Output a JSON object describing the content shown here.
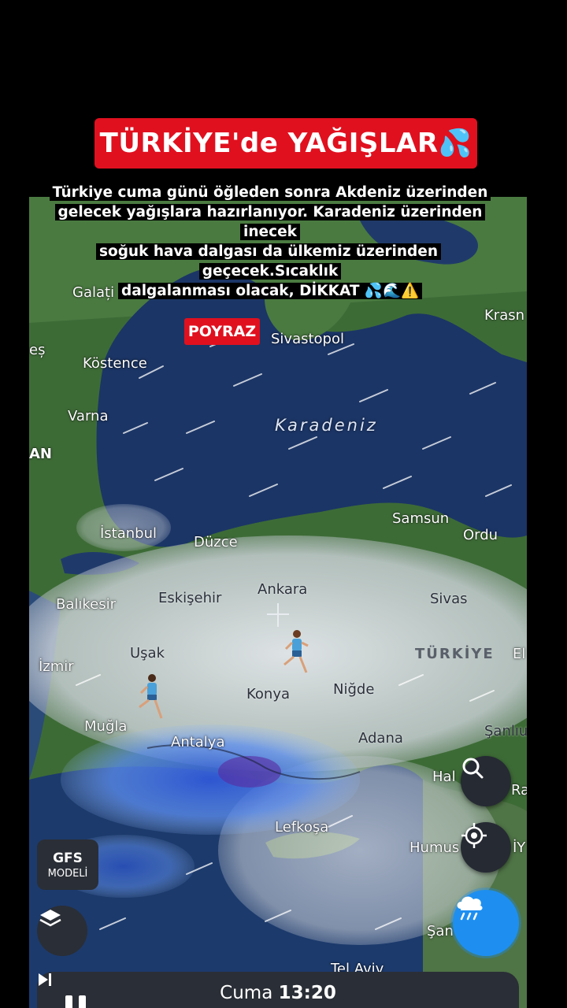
{
  "title": "TÜRKİYE'de YAĞIŞLAR💦",
  "caption_lines": [
    "Türkiye cuma günü öğleden sonra Akdeniz üzerinden",
    "gelecek yağışlara hazırlanıyor. Karadeniz üzerinden inecek",
    "soğuk hava dalgası da ülkemiz üzerinden geçecek.Sıcaklık",
    "dalgalanması olacak, DİKKAT 💦🌊⚠️"
  ],
  "map": {
    "badge": "POYRAZ",
    "sea_label": "Karadeniz",
    "country_label": "TÜRKİYE",
    "cities": {
      "galati": "Galați",
      "krasn": "Krasn",
      "es": "eș",
      "sivastopol": "Sivastopol",
      "kostence": "Köstence",
      "varna": "Varna",
      "an": "AN",
      "samsun": "Samsun",
      "ordu": "Ordu",
      "istanbul": "İstanbul",
      "duzce": "Düzce",
      "ankara": "Ankara",
      "balikesir": "Balıkesir",
      "eskisehir": "Eskişehir",
      "sivas": "Sivas",
      "usak": "Uşak",
      "el": "El",
      "izmir": "İzmir",
      "nigde": "Niğde",
      "konya": "Konya",
      "mugla": "Muğla",
      "sanliurfa": "Şanlıu",
      "antalya": "Antalya",
      "adana": "Adana",
      "hal": "Hal",
      "ra": "Ra",
      "lefkosa": "Lefkoşa",
      "humus": "Humus",
      "iy": "İY",
      "san": "Şan",
      "telaviv": "Tel Aviv"
    }
  },
  "controls": {
    "model_label_1": "GFS",
    "model_label_2": "MODELİ",
    "day": "Cuma",
    "time": "13:20"
  },
  "icons": [
    "search-icon",
    "locate-icon",
    "rain-icon",
    "layers-icon",
    "pause-icon",
    "skip-icon",
    "crosshair-icon"
  ],
  "colors": {
    "banner_red": "#e0101f",
    "sea": "#1b3566",
    "land": "#3d6b36",
    "rain_blue": "#3b7be6",
    "button_blue": "#1e8ff0"
  }
}
